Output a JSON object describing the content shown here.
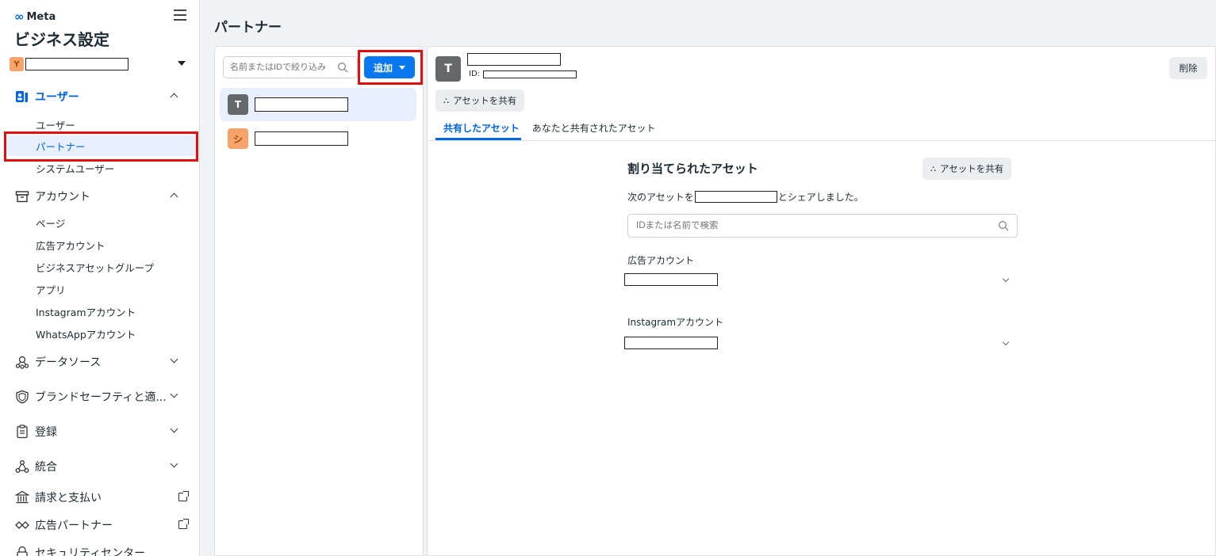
{
  "sidebar": {
    "brand": "Meta",
    "app_title": "ビジネス設定",
    "account_initial": "Y",
    "groups": {
      "users": "ユーザー",
      "accounts": "アカウント",
      "data_sources": "データソース",
      "brand_safety": "ブランドセーフティと適...",
      "registrations": "登録",
      "integrations": "統合",
      "billing": "請求と支払い",
      "ad_partners": "広告パートナー",
      "security": "セキュリティセンター"
    },
    "user_items": [
      "ユーザー",
      "パートナー",
      "システムユーザー"
    ],
    "account_items": [
      "ページ",
      "広告アカウント",
      "ビジネスアセットグループ",
      "アプリ",
      "Instagramアカウント",
      "WhatsAppアカウント"
    ]
  },
  "header": {
    "title": "パートナー"
  },
  "partner_list": {
    "search_placeholder": "名前またはIDで絞り込み",
    "add_label": "追加",
    "partners": [
      {
        "initial": "T",
        "selected": true
      },
      {
        "initial": "シ",
        "selected": false
      }
    ]
  },
  "detail": {
    "avatar_initial": "T",
    "id_label": "ID:",
    "delete_label": "削除",
    "share_label": "アセットを共有",
    "tabs": [
      "共有したアセット",
      "あなたと共有されたアセット"
    ],
    "assigned_title": "割り当てられたアセット",
    "share_label_2": "アセットを共有",
    "shared_prefix": "次のアセットを",
    "shared_suffix": "とシェアしました。",
    "asset_search_placeholder": "IDまたは名前で検索",
    "sections": [
      "広告アカウント",
      "Instagramアカウント"
    ]
  },
  "colors": {
    "accent": "#0064e0",
    "button_blue": "#0a78f0",
    "highlight_red": "#e01010",
    "avatar_orange": "#f7a36b"
  }
}
